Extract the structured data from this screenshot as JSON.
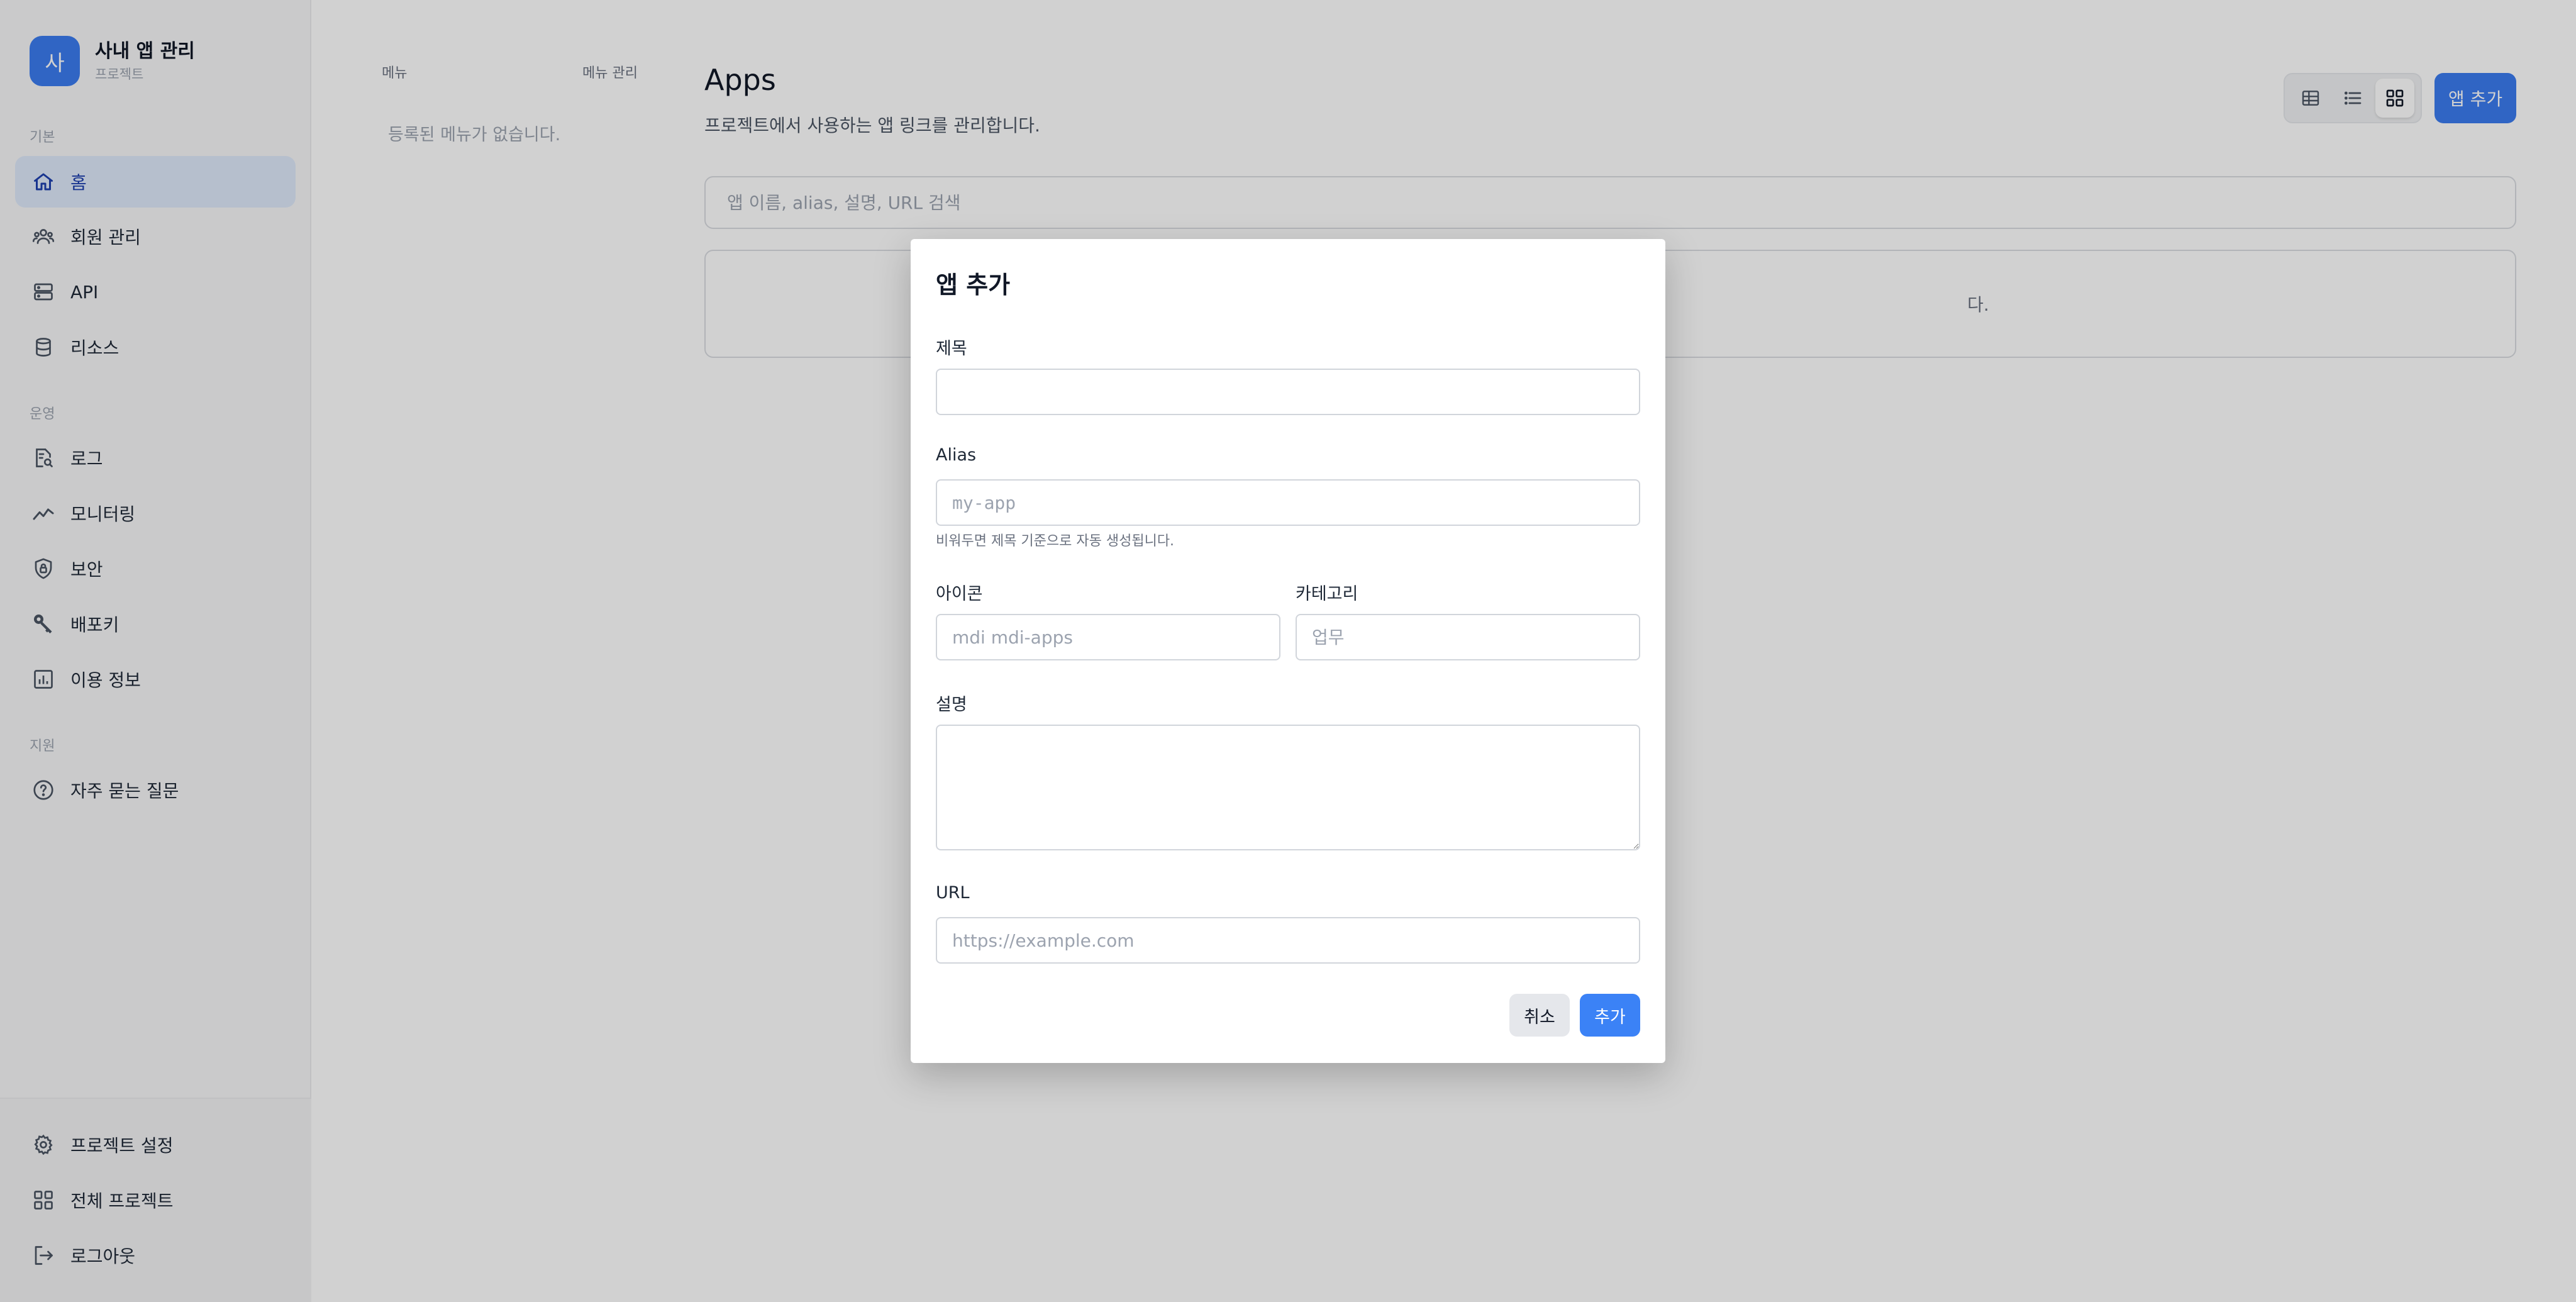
{
  "sidebar": {
    "brand": {
      "avatar_letter": "사",
      "title": "사내 앱 관리",
      "subtitle": "프로젝트"
    },
    "sections": [
      {
        "label": "기본",
        "items": [
          {
            "label": "홈",
            "icon": "home-icon",
            "active": true
          },
          {
            "label": "회원 관리",
            "icon": "users-icon"
          },
          {
            "label": "API",
            "icon": "server-icon"
          },
          {
            "label": "리소스",
            "icon": "database-icon"
          }
        ]
      },
      {
        "label": "운영",
        "items": [
          {
            "label": "로그",
            "icon": "log-search-icon"
          },
          {
            "label": "모니터링",
            "icon": "trend-icon"
          },
          {
            "label": "보안",
            "icon": "shield-lock-icon"
          },
          {
            "label": "배포키",
            "icon": "key-icon"
          },
          {
            "label": "이용 정보",
            "icon": "bar-chart-icon"
          }
        ]
      },
      {
        "label": "지원",
        "items": [
          {
            "label": "자주 묻는 질문",
            "icon": "help-circle-icon"
          }
        ]
      }
    ],
    "bottom_items": [
      {
        "label": "프로젝트 설정",
        "icon": "gear-icon"
      },
      {
        "label": "전체 프로젝트",
        "icon": "grid-icon"
      },
      {
        "label": "로그아웃",
        "icon": "logout-icon"
      }
    ]
  },
  "menu_panel": {
    "header_left": "메뉴",
    "header_right": "메뉴 관리",
    "empty_text": "등록된 메뉴가 없습니다."
  },
  "main": {
    "title": "Apps",
    "subtitle": "프로젝트에서 사용하는 앱 링크를 관리합니다.",
    "add_button": "앱 추가",
    "view_modes": [
      "table-view-icon",
      "list-view-icon",
      "grid-view-icon"
    ],
    "active_view": "grid-view-icon",
    "search_placeholder": "앱 이름, alias, 설명, URL 검색",
    "empty_text_visible": "다."
  },
  "modal": {
    "title": "앱 추가",
    "fields": {
      "title": {
        "label": "제목",
        "value": "",
        "placeholder": ""
      },
      "alias": {
        "label": "Alias",
        "placeholder": "my-app",
        "help": "비워두면 제목 기준으로 자동 생성됩니다."
      },
      "icon": {
        "label": "아이콘",
        "placeholder": "mdi mdi-apps"
      },
      "category": {
        "label": "카테고리",
        "placeholder": "업무"
      },
      "description": {
        "label": "설명",
        "placeholder": ""
      },
      "url": {
        "label": "URL",
        "placeholder": "https://example.com"
      }
    },
    "cancel_label": "취소",
    "submit_label": "추가"
  },
  "colors": {
    "accent": "#3b7cf0",
    "active_nav_bg": "#dfe9fb",
    "overlay": "rgba(0,0,0,0.18)"
  }
}
